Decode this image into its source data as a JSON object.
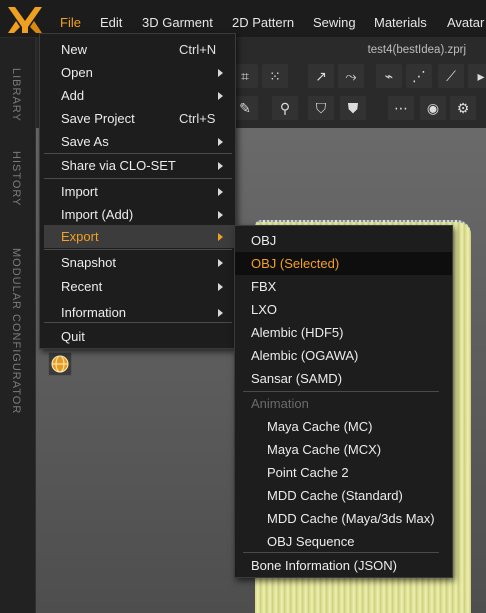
{
  "menubar": {
    "items": [
      "File",
      "Edit",
      "3D Garment",
      "2D Pattern",
      "Sewing",
      "Materials",
      "Avatar"
    ],
    "active": "File"
  },
  "toolbar": {
    "filename": "test4(bestIdea).zprj"
  },
  "leftpanel": {
    "labels": [
      "LIBRARY",
      "HISTORY",
      "MODULAR CONFIGURATOR"
    ]
  },
  "file_menu": {
    "items": [
      {
        "label": "New",
        "shortcut": "Ctrl+N"
      },
      {
        "label": "Open",
        "submenu": true
      },
      {
        "label": "Add",
        "submenu": true
      },
      {
        "label": "Save Project",
        "shortcut": "Ctrl+S"
      },
      {
        "label": "Save As",
        "submenu": true
      },
      {
        "label": "Share via CLO-SET",
        "submenu": true
      },
      {
        "label": "Import",
        "submenu": true
      },
      {
        "label": "Import (Add)",
        "submenu": true
      },
      {
        "label": "Export",
        "submenu": true,
        "highlighted": true
      },
      {
        "label": "Snapshot",
        "submenu": true
      },
      {
        "label": "Recent",
        "submenu": true
      },
      {
        "label": "Information",
        "submenu": true
      },
      {
        "label": "Quit"
      }
    ]
  },
  "export_menu": {
    "items": [
      {
        "label": "OBJ"
      },
      {
        "label": "OBJ (Selected)",
        "selected": true
      },
      {
        "label": "FBX"
      },
      {
        "label": "LXO"
      },
      {
        "label": "Alembic (HDF5)"
      },
      {
        "label": "Alembic (OGAWA)"
      },
      {
        "label": "Sansar (SAMD)"
      },
      {
        "label": "Animation",
        "disabled": true
      },
      {
        "label": "Maya Cache (MC)",
        "indent": true
      },
      {
        "label": "Maya Cache (MCX)",
        "indent": true
      },
      {
        "label": "Point Cache 2",
        "indent": true
      },
      {
        "label": "MDD Cache (Standard)",
        "indent": true
      },
      {
        "label": "MDD Cache (Maya/3ds Max)",
        "indent": true
      },
      {
        "label": "OBJ Sequence",
        "indent": true
      },
      {
        "label": "Bone Information (JSON)"
      }
    ]
  },
  "colors": {
    "accent": "#f4a020",
    "menu_bg": "#1d1d1d"
  }
}
